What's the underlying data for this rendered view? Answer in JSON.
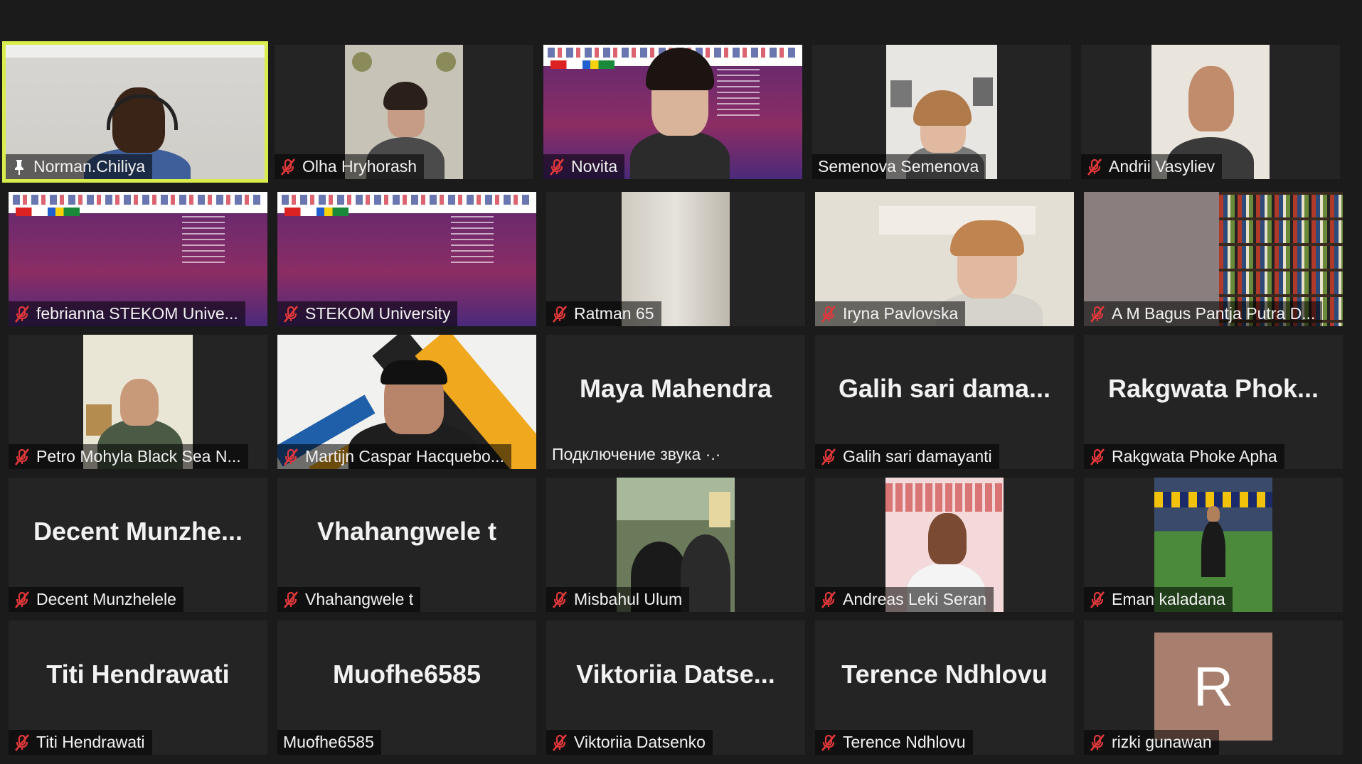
{
  "colors": {
    "background": "#1b1b1b",
    "tile": "#242424",
    "active_speaker_border": "#d9ee4d",
    "muted_icon": "#e0383b",
    "avatar_bg": "#a87f6e"
  },
  "participants": [
    {
      "name": "Norman.Chiliya",
      "muted": false,
      "pinned": true,
      "video": true,
      "active_speaker": true
    },
    {
      "name": "Olha Hryhorash",
      "muted": true,
      "video": true
    },
    {
      "name": "Novita",
      "muted": true,
      "video": true
    },
    {
      "name": "Semenova Semenova",
      "muted": false,
      "video": true
    },
    {
      "name": "Andrii Vasyliev",
      "muted": true,
      "video": true
    },
    {
      "name": "febrianna STEKOM Unive...",
      "muted": true,
      "video": true
    },
    {
      "name": "STEKOM University",
      "muted": true,
      "video": true
    },
    {
      "name": "Ratman 65",
      "muted": true,
      "video": true
    },
    {
      "name": "Iryna Pavlovska",
      "muted": true,
      "video": true
    },
    {
      "name": "A M Bagus Pantja Putra D...",
      "muted": true,
      "video": true
    },
    {
      "name": "Petro Mohyla Black Sea N...",
      "muted": true,
      "video": true
    },
    {
      "name": "Martijn Caspar Hacquebo...",
      "muted": true,
      "video": true
    },
    {
      "name": "Maya Mahendra",
      "muted": false,
      "video": false,
      "display_name": "Maya Mahendra",
      "status": "Подключение звука ·.·"
    },
    {
      "name": "Galih sari damayanti",
      "muted": true,
      "video": false,
      "display_name": "Galih  sari  dama..."
    },
    {
      "name": "Rakgwata Phoke Apha",
      "muted": true,
      "video": false,
      "display_name": "Rakgwata  Phok..."
    },
    {
      "name": "Decent Munzhelele",
      "muted": true,
      "video": false,
      "display_name": "Decent  Munzhe..."
    },
    {
      "name": "Vhahangwele t",
      "muted": true,
      "video": false,
      "display_name": "Vhahangwele t"
    },
    {
      "name": "Misbahul Ulum",
      "muted": true,
      "video": true
    },
    {
      "name": "Andreas Leki Seran",
      "muted": true,
      "video": true
    },
    {
      "name": "Eman kaladana",
      "muted": true,
      "video": true
    },
    {
      "name": "Titi Hendrawati",
      "muted": true,
      "video": false,
      "display_name": "Titi Hendrawati"
    },
    {
      "name": "Muofhe6585",
      "muted": false,
      "video": false,
      "display_name": "Muofhe6585"
    },
    {
      "name": "Viktoriia Datsenko",
      "muted": true,
      "video": false,
      "display_name": "Viktoriia  Datse..."
    },
    {
      "name": "Terence Ndhlovu",
      "muted": true,
      "video": false,
      "display_name": "Terence Ndhlovu"
    },
    {
      "name": "rizki gunawan",
      "muted": true,
      "video": false,
      "avatar_letter": "R"
    }
  ]
}
